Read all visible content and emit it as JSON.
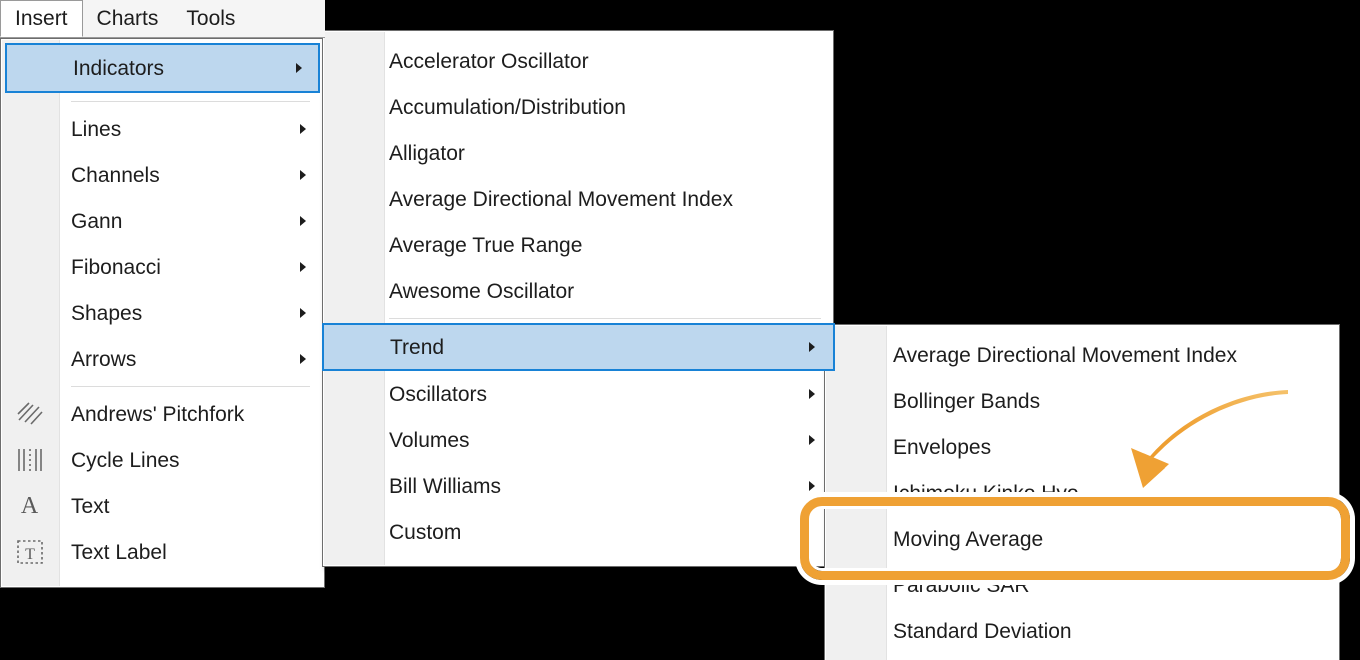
{
  "menubar": {
    "tabs": [
      {
        "label": "Insert",
        "active": true
      },
      {
        "label": "Charts",
        "active": false
      },
      {
        "label": "Tools",
        "active": false
      }
    ]
  },
  "insert_menu": {
    "selected_item": "Indicators",
    "items": [
      {
        "label": "Indicators",
        "submenu": true,
        "selected": true
      },
      {
        "label": "Lines",
        "submenu": true
      },
      {
        "label": "Channels",
        "submenu": true
      },
      {
        "label": "Gann",
        "submenu": true
      },
      {
        "label": "Fibonacci",
        "submenu": true
      },
      {
        "label": "Shapes",
        "submenu": true
      },
      {
        "label": "Arrows",
        "submenu": true
      },
      {
        "label": "Andrews' Pitchfork",
        "submenu": false,
        "icon": "pitchfork-icon"
      },
      {
        "label": "Cycle Lines",
        "submenu": false,
        "icon": "cycle-lines-icon"
      },
      {
        "label": "Text",
        "submenu": false,
        "icon": "text-a-icon"
      },
      {
        "label": "Text Label",
        "submenu": false,
        "icon": "text-label-icon"
      }
    ]
  },
  "indicators_menu": {
    "selected_item": "Trend",
    "items": [
      {
        "label": "Accelerator Oscillator",
        "submenu": false
      },
      {
        "label": "Accumulation/Distribution",
        "submenu": false
      },
      {
        "label": "Alligator",
        "submenu": false
      },
      {
        "label": "Average Directional Movement Index",
        "submenu": false
      },
      {
        "label": "Average True Range",
        "submenu": false
      },
      {
        "label": "Awesome Oscillator",
        "submenu": false
      },
      {
        "label": "Trend",
        "submenu": true,
        "selected": true
      },
      {
        "label": "Oscillators",
        "submenu": true
      },
      {
        "label": "Volumes",
        "submenu": true
      },
      {
        "label": "Bill Williams",
        "submenu": true
      },
      {
        "label": "Custom",
        "submenu": false
      }
    ]
  },
  "trend_menu": {
    "highlighted_item": "Moving Average",
    "items": [
      {
        "label": "Average Directional Movement Index"
      },
      {
        "label": "Bollinger Bands"
      },
      {
        "label": "Envelopes"
      },
      {
        "label": "Ichimoku Kinko Hyo"
      },
      {
        "label": "Moving Average",
        "highlighted": true
      },
      {
        "label": "Parabolic SAR"
      },
      {
        "label": "Standard Deviation"
      }
    ]
  },
  "annotations": {
    "highlight_color": "#efa134",
    "arrow_name": "curved-arrow-pointing-to-moving-average",
    "box_target": "Moving Average"
  },
  "colors": {
    "selection_fill": "#bdd7ee",
    "selection_border": "#1882d6",
    "menu_bg": "#ffffff",
    "gutter_bg": "#f0f0f0",
    "text": "#1d1d1d",
    "backdrop": "#000000"
  }
}
